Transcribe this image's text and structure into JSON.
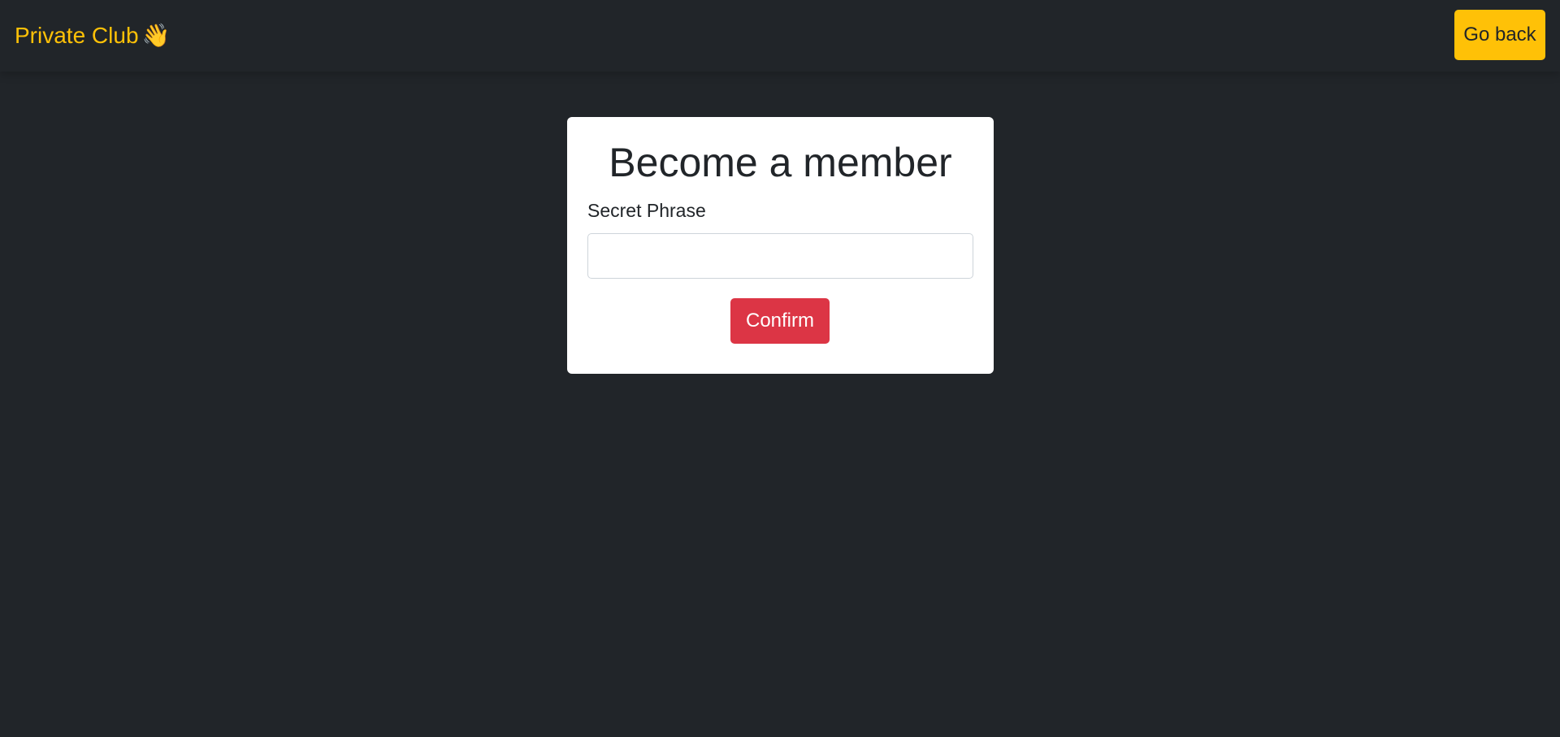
{
  "navbar": {
    "brand_label": "Private Club",
    "brand_emoji": "👋",
    "go_back_label": "Go back"
  },
  "card": {
    "title": "Become a member",
    "field_label": "Secret Phrase",
    "field_value": "",
    "field_placeholder": "",
    "confirm_label": "Confirm"
  },
  "colors": {
    "page_background": "#212529",
    "brand": "#ffc107",
    "go_back_button": "#ffc107",
    "confirm_button": "#dc3545",
    "card_background": "#ffffff"
  },
  "icons": {
    "brand_icon": "waving-hand-icon"
  }
}
